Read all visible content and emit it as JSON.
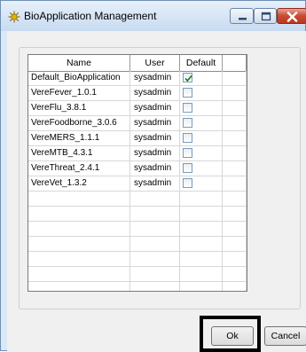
{
  "window": {
    "title": "BioApplication Management",
    "icon": "virus-icon"
  },
  "grid": {
    "columns": [
      "Name",
      "User",
      "Default"
    ],
    "rows": [
      {
        "name": "Default_BioApplication",
        "user": "sysadmin",
        "default": true
      },
      {
        "name": "VereFever_1.0.1",
        "user": "sysadmin",
        "default": false
      },
      {
        "name": "VereFlu_3.8.1",
        "user": "sysadmin",
        "default": false
      },
      {
        "name": "VereFoodborne_3.0.6",
        "user": "sysadmin",
        "default": false
      },
      {
        "name": "VereMERS_1.1.1",
        "user": "sysadmin",
        "default": false
      },
      {
        "name": "VereMTB_4.3.1",
        "user": "sysadmin",
        "default": false
      },
      {
        "name": "VereThreat_2.4.1",
        "user": "sysadmin",
        "default": false
      },
      {
        "name": "VereVet_1.3.2",
        "user": "sysadmin",
        "default": false
      }
    ],
    "empty_row_count": 8
  },
  "buttons": {
    "ok": "Ok",
    "cancel": "Cancel"
  }
}
